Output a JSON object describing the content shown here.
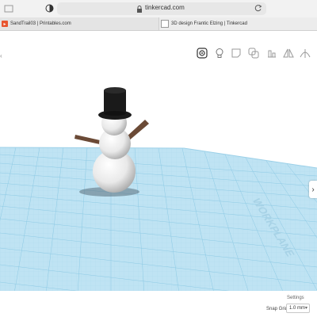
{
  "browser": {
    "url": "tinkercad.com",
    "tabs": [
      {
        "label": "SandTrail03 | Printables.com",
        "favicon": "printables-icon"
      },
      {
        "label": "3D design Frantic Elzing | Tinkercad",
        "favicon": "tinkercad-icon"
      }
    ]
  },
  "toolbar": {
    "icons": [
      "camera-view-icon",
      "light-bulb-icon",
      "note-icon",
      "group-icon",
      "align-icon",
      "flip-icon",
      "mirror-icon"
    ]
  },
  "workplane": {
    "label": "WORKPLANE",
    "grid_color": "#b8dff0",
    "line_color": "#7fc1e0"
  },
  "model": {
    "name": "snowman",
    "body_color": "#f2f2f2",
    "hat_color": "#1a1a1a",
    "arm_color": "#6b4a36"
  },
  "footer": {
    "settings_label": "Settings",
    "snap_grid_label": "Snap Grid",
    "snap_grid_value": "1.0 mm"
  }
}
